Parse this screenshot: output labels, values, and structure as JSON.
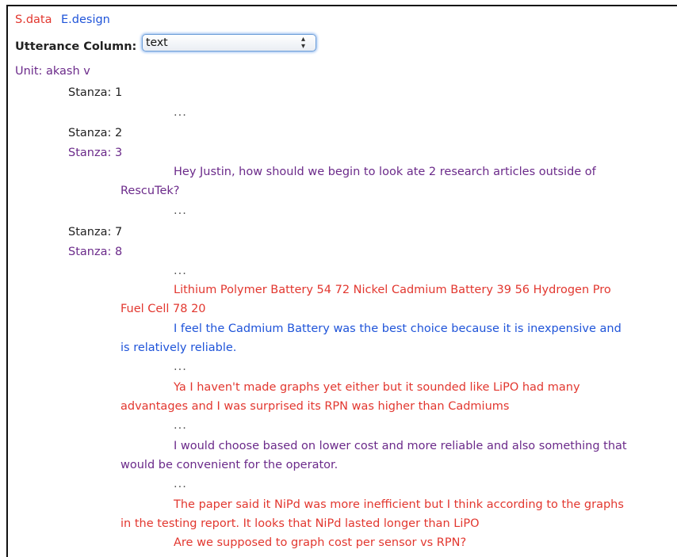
{
  "legend": {
    "sdata": "S.data",
    "edesign": "E.design"
  },
  "controls": {
    "utterance_label": "Utterance Column:",
    "utterance_value": "text"
  },
  "unit": "Unit: akash v",
  "stanzas": [
    "Stanza: 1",
    "Stanza: 2",
    "Stanza: 3",
    "Stanza: 7",
    "Stanza: 8"
  ],
  "ellipsis": "...",
  "utterances": {
    "u1": {
      "line1": "Hey Justin, how should we begin to look ate 2 research articles outside of",
      "line2": "RescuTek?"
    },
    "u2": {
      "line1": "Lithium Polymer Battery 54 72 Nickel Cadmium Battery 39 56 Hydrogen Pro",
      "line2": "Fuel Cell 78 20"
    },
    "u3": {
      "line1": "I feel the Cadmium Battery was the best choice because it is inexpensive and",
      "line2": "is relatively reliable."
    },
    "u4": {
      "line1": "Ya I haven't made graphs yet either but it sounded like LiPO had many",
      "line2": "advantages and I was surprised its RPN was higher than Cadmiums"
    },
    "u5": {
      "line1": "I would choose based on lower cost and more reliable and also something that",
      "line2": "would be convenient for the operator."
    },
    "u6": {
      "line1": "The paper said it NiPd was more inefficient but I think according to the graphs",
      "line2": "in the testing report. It looks that NiPd lasted longer than LiPO"
    },
    "u7": {
      "line1": "Are we supposed to graph cost per sensor vs RPN?"
    }
  },
  "colors": {
    "purple": "#6b2a8a",
    "red": "#e2372f",
    "blue": "#1f54d9",
    "text": "#222222"
  }
}
